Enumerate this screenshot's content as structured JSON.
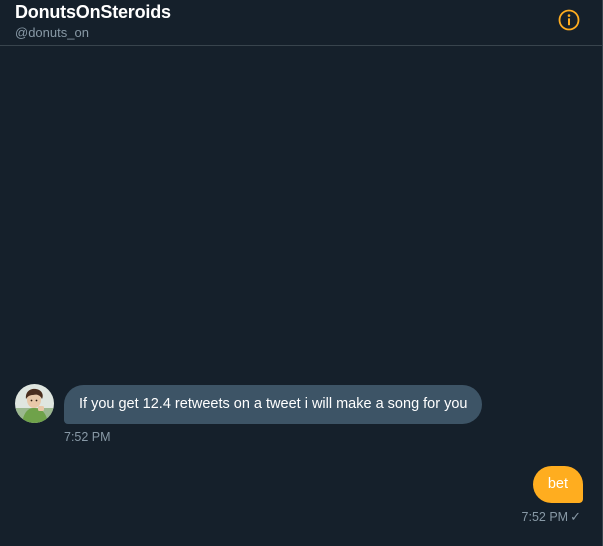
{
  "header": {
    "name": "DonutsOnSteroids",
    "handle": "@donuts_on",
    "info_icon": "info-circle-icon"
  },
  "messages": [
    {
      "direction": "incoming",
      "text": "If you get 12.4 retweets on a tweet i will make a song for you",
      "time": "7:52 PM",
      "avatar_icon": "user-avatar"
    },
    {
      "direction": "outgoing",
      "text": "bet",
      "time": "7:52 PM",
      "status_icon": "check-icon"
    }
  ],
  "colors": {
    "background": "#15202b",
    "divider": "#38444d",
    "incoming_bubble": "#3d5466",
    "outgoing_bubble": "#ffad1f",
    "accent": "#ffad1f",
    "muted_text": "#8899a6"
  }
}
